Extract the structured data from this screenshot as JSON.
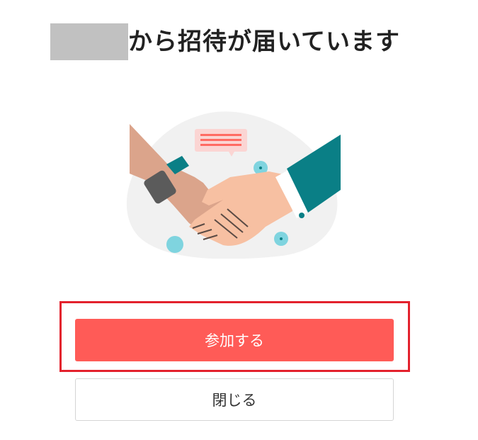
{
  "title": {
    "suffix": "から招待が届いています"
  },
  "illustration": {
    "icon": "handshake-illustration"
  },
  "buttons": {
    "join_label": "参加する",
    "close_label": "閉じる"
  },
  "colors": {
    "primary": "#ff5b57",
    "highlight": "#e3212d",
    "sleeve": "#0a7f86",
    "accent_dot": "#7fd4df"
  }
}
